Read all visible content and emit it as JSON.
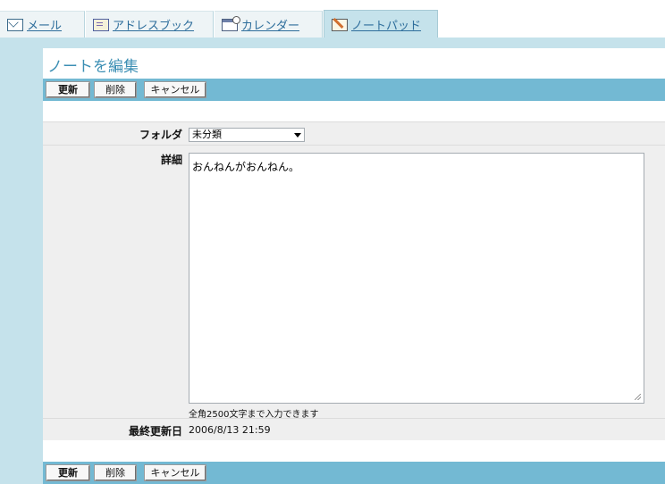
{
  "tabs": [
    {
      "label": "メール",
      "icon": "mail-icon"
    },
    {
      "label": "アドレスブック",
      "icon": "address-book-icon"
    },
    {
      "label": "カレンダー",
      "icon": "calendar-icon"
    },
    {
      "label": "ノートパッド",
      "icon": "notepad-icon",
      "active": true
    }
  ],
  "page": {
    "title": "ノートを編集"
  },
  "buttons": {
    "update": "更新",
    "delete": "削除",
    "cancel": "キャンセル"
  },
  "form": {
    "folder_label": "フォルダ",
    "folder_value": "未分類",
    "detail_label": "詳細",
    "detail_value": "おんねんがおんねん。",
    "detail_hint": "全角2500文字まで入力できます",
    "updated_label": "最終更新日",
    "updated_value": "2006/8/13 21:59"
  },
  "colors": {
    "accent": "#73b9d3",
    "sidebar": "#c5e2eb",
    "title": "#3c8fb4",
    "link": "#2d6d9b"
  }
}
